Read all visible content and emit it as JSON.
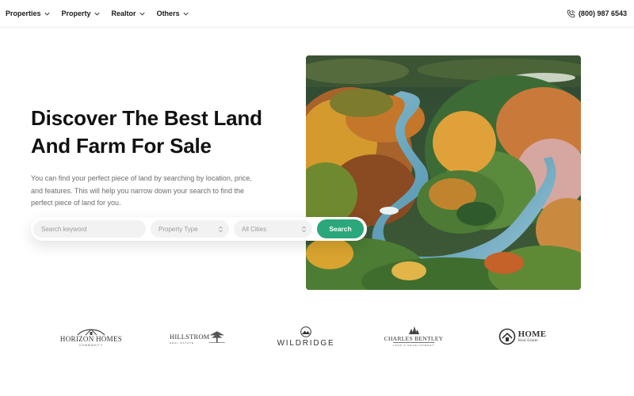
{
  "nav": {
    "items": [
      {
        "label": "Properties"
      },
      {
        "label": "Property"
      },
      {
        "label": "Realtor"
      },
      {
        "label": "Others"
      }
    ],
    "phone": "(800) 987 6543"
  },
  "hero": {
    "title_line1": "Discover The Best Land",
    "title_line2": "And Farm For Sale",
    "description": "You can find your perfect piece of land by searching by location, price, and features. This will help you narrow down your search to find the perfect piece of land for you."
  },
  "search": {
    "keyword_placeholder": "Search keyword",
    "property_type": "Property Type",
    "city": "All Cities",
    "button_label": "Search"
  },
  "colors": {
    "accent": "#2aa77b",
    "text": "#111111",
    "muted": "#6b6b6b"
  },
  "logos": [
    {
      "name": "HORIZON HOMES",
      "sub": "COMMUNITY"
    },
    {
      "name": "HILLSTROM",
      "sub": "REAL ESTATE"
    },
    {
      "name": "WILDRIDGE"
    },
    {
      "name": "CHARLES BENTLEY",
      "sub": "LAND & DEVELOPMENT"
    },
    {
      "name": "HOME",
      "sub": "Real Estate"
    }
  ]
}
